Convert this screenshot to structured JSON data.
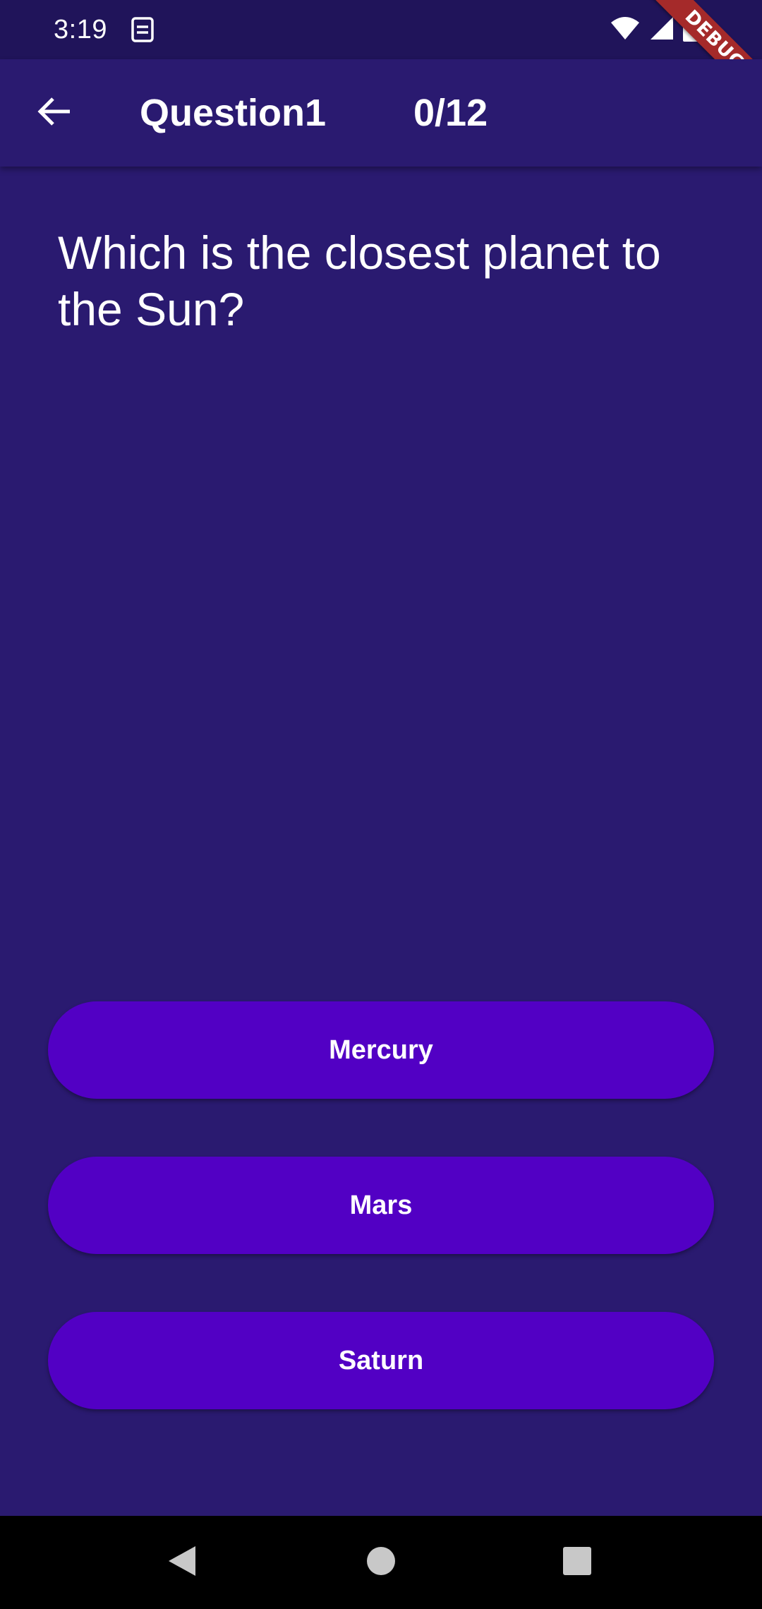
{
  "status_bar": {
    "time": "3:19",
    "app_icon": "sim-icon",
    "icons": [
      "wifi-icon",
      "signal-icon",
      "battery-icon"
    ],
    "debug_banner": "DEBUG"
  },
  "app_bar": {
    "back_icon": "arrow-back-icon",
    "title": "Question1",
    "progress": "0/12"
  },
  "question": {
    "text": "Which is the closest planet to the Sun?"
  },
  "answers": [
    {
      "label": "Mercury"
    },
    {
      "label": "Mars"
    },
    {
      "label": "Saturn"
    }
  ],
  "nav_bar": {
    "icons": [
      "back-triangle-icon",
      "home-circle-icon",
      "recents-square-icon"
    ]
  },
  "colors": {
    "background": "#2a1a70",
    "status_bar": "#20145a",
    "button": "#5200c4",
    "debug_banner": "#a52a2a"
  }
}
